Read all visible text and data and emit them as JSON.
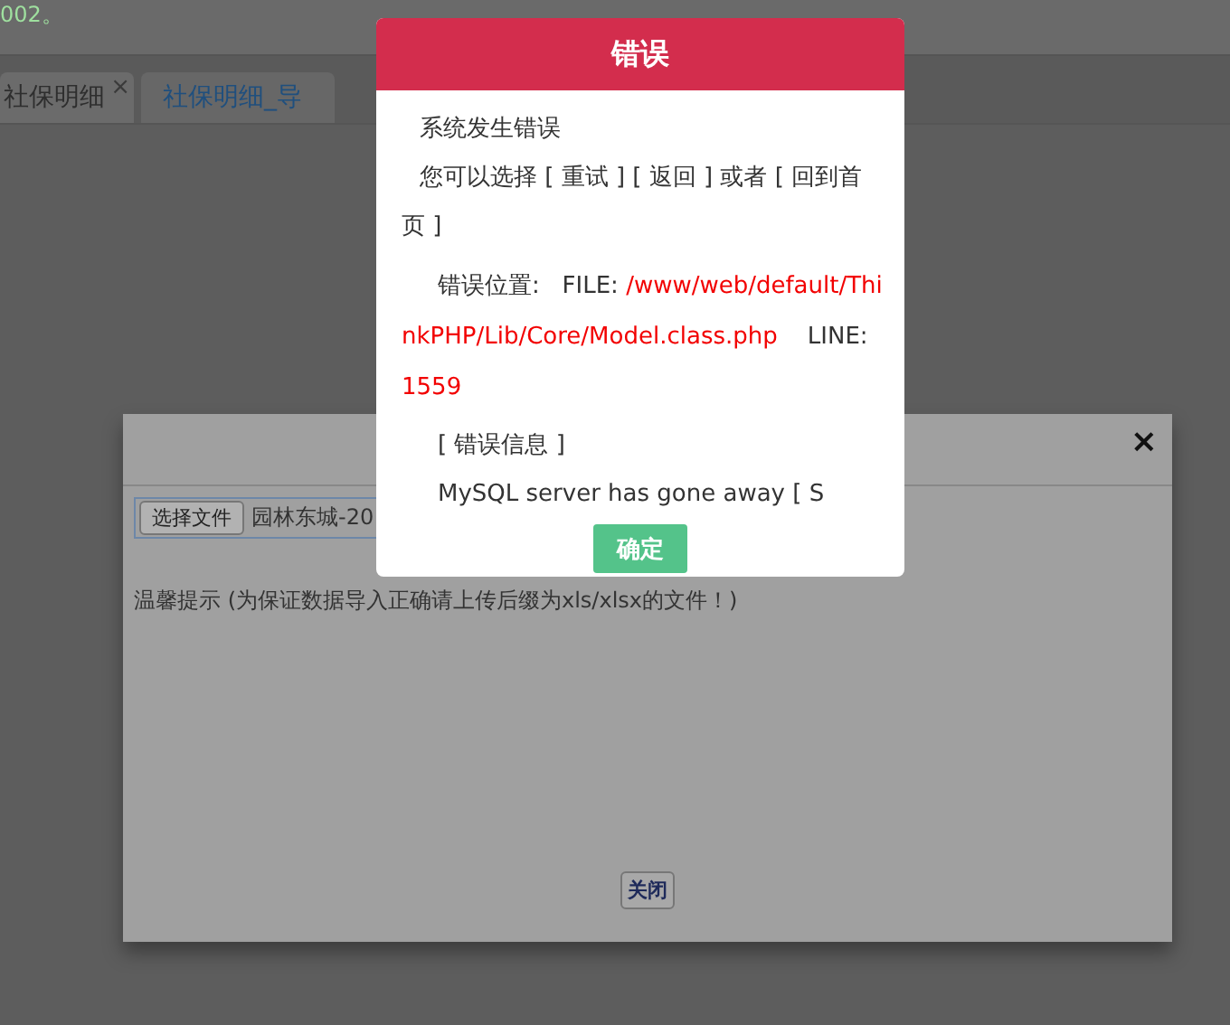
{
  "page": {
    "top_text": "002。",
    "tabs": [
      {
        "label": "社保明细",
        "selected": false,
        "close_icon": "×"
      },
      {
        "label": "社保明细_导",
        "selected": true
      }
    ]
  },
  "import_dialog": {
    "close": "×",
    "file_button": "选择文件",
    "file_name": "园林东城-20",
    "hint": "温馨提示 (为保证数据导入正确请上传后缀为xls/xlsx的文件！)",
    "close_button": "关闭"
  },
  "error_dialog": {
    "title": "错误",
    "heading": "系统发生错误",
    "choices": "您可以选择 [ 重试 ] [ 返回 ] 或者 [ 回到首页 ]",
    "location_label": "错误位置:",
    "file_label": "FILE:",
    "file_path": "/www/web/default/ThinkPHP/Lib/Core/Model.class.php",
    "line_label": "LINE:",
    "line_number": "1559",
    "info_heading": "[ 错误信息 ]",
    "message": "MySQL server has gone away [ S",
    "ok_button": "确定"
  }
}
